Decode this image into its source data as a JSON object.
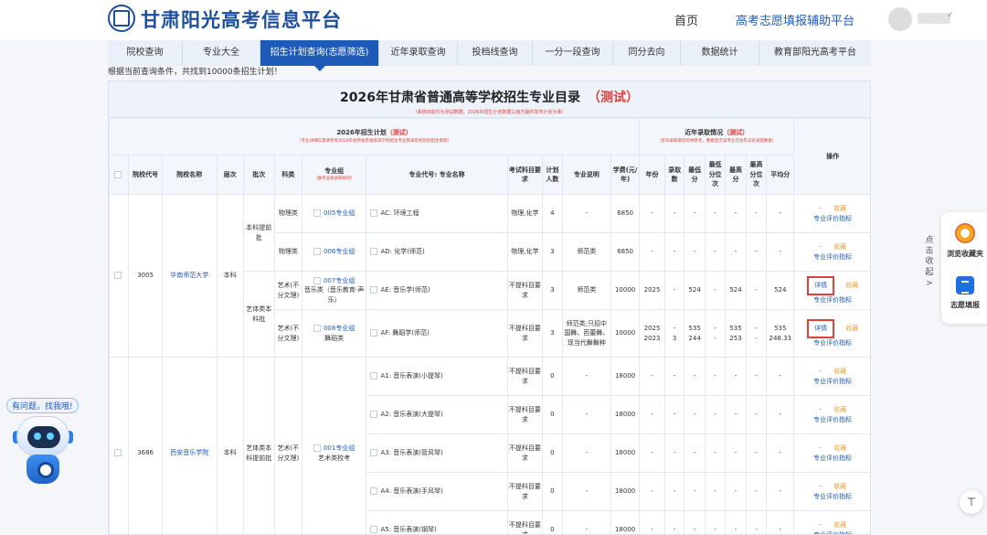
{
  "header": {
    "site_title": "甘肃阳光高考信息平台",
    "nav_home": "首页",
    "nav_assist": "高考志愿填报辅助平台"
  },
  "tabs": [
    {
      "label": "院校查询"
    },
    {
      "label": "专业大全"
    },
    {
      "label": "招生计划查询(志愿筛选)",
      "active": true
    },
    {
      "label": "近年录取查询"
    },
    {
      "label": "投档线查询"
    },
    {
      "label": "一分一段查询"
    },
    {
      "label": "同分去向"
    },
    {
      "label": "数据统计"
    },
    {
      "label": "教育部阳光高考平台"
    }
  ],
  "result_count_text": "根据当前查询条件，共找到10000条招生计划！",
  "catalog": {
    "title": "2026年甘肃省普通高等学校招生专业目录",
    "title_tag": "（测试）",
    "notice": "（系统目前均为测试数据，2026年招生计划数据以官方最终发布计划为准）"
  },
  "table": {
    "plan_section": {
      "title": "2026年招生计划",
      "tag": "（测试）",
      "note": "（专业详细信息请参考2026年甘肃省普通高等学校招生专业目录及各院校招生章程）"
    },
    "history_section": {
      "title": "近年录取情况",
      "tag": "（测试）",
      "note": "（近年录取情况仅供参考，数据显示该专业在往年没有录取数据）"
    },
    "ops_header": "操作",
    "headers": {
      "school_code": "院校代号",
      "school_name": "院校名称",
      "level": "层次",
      "batch": "批次",
      "subject": "科类",
      "group": "专业组",
      "group_note": "（备专业组录取规则）",
      "major": "专业代号: 专业名称",
      "requirement": "考试科目要求",
      "plan_count": "计划人数",
      "major_note": "专业说明",
      "tuition": "学费(元/年)",
      "year": "年份",
      "admitted": "录取数",
      "min_score": "最低分",
      "min_rank": "最低分位次",
      "max_score": "最高分",
      "max_rank": "最高分位次",
      "avg_score": "平均分"
    },
    "ops": {
      "fav": "收藏",
      "eval": "专业评价指标",
      "detail": "详情",
      "dash": "-"
    },
    "s1": {
      "code": "3005",
      "name": "华南师范大学",
      "level": "本科",
      "batch_a": "本科提前批",
      "batch_b": "艺体类本科批",
      "r1": {
        "subject": "物理类",
        "group": "005专业组",
        "major": "AC: 环境工程",
        "req": "物理,化学",
        "count": "4",
        "note": "-",
        "fee": "6850",
        "year": "-",
        "adm": "-",
        "mins": "-",
        "minr": "-",
        "maxs": "-",
        "maxr": "-",
        "avg": "-"
      },
      "r2": {
        "subject": "物理类",
        "group": "006专业组",
        "major": "AD: 化学(师范)",
        "req": "物理,化学",
        "count": "3",
        "note": "师范类",
        "fee": "6850",
        "year": "-",
        "adm": "-",
        "mins": "-",
        "minr": "-",
        "maxs": "-",
        "maxr": "-",
        "avg": "-"
      },
      "r3": {
        "subject": "艺术(不分文理)",
        "group": "007专业组",
        "group_desc": "音乐类（音乐教育-声乐）",
        "major": "AE: 音乐学(师范)",
        "req": "不提科目要求",
        "count": "3",
        "note": "师范类",
        "fee": "10000",
        "year": "2025",
        "adm": "-",
        "mins": "524",
        "minr": "-",
        "maxs": "524",
        "maxr": "-",
        "avg": "524"
      },
      "r4": {
        "subject": "艺术(不分文理)",
        "group": "008专业组",
        "group_desc": "舞蹈类",
        "major": "AF: 舞蹈学(师范)",
        "req": "不提科目要求",
        "count": "3",
        "note": "师范类;只招中国舞、芭蕾舞、现当代舞舞种",
        "fee": "10000",
        "year1": "2025",
        "adm1": "-",
        "mins1": "535",
        "minr1": "-",
        "maxs1": "535",
        "maxr1": "-",
        "avg1": "535",
        "year2": "2023",
        "adm2": "3",
        "mins2": "244",
        "minr2": "-",
        "maxs2": "253",
        "maxr2": "-",
        "avg2": "248.33"
      }
    },
    "s2": {
      "code": "3686",
      "name": "西安音乐学院",
      "level": "本科",
      "batch": "艺体类本科提前批",
      "subject": "艺术(不分文理)",
      "group": "001专业组",
      "group_desc": "艺术类校考",
      "rows": [
        {
          "major": "A1: 音乐表演(小提琴)",
          "req": "不提科目要求",
          "count": "0",
          "note": "-",
          "fee": "18000"
        },
        {
          "major": "A2: 音乐表演(大提琴)",
          "req": "不提科目要求",
          "count": "0",
          "note": "-",
          "fee": "18000"
        },
        {
          "major": "A3: 音乐表演(管风琴)",
          "req": "不提科目要求",
          "count": "0",
          "note": "-",
          "fee": "18000"
        },
        {
          "major": "A4: 音乐表演(手风琴)",
          "req": "不提科目要求",
          "count": "0",
          "note": "-",
          "fee": "18000"
        },
        {
          "major": "A5: 音乐表演(钢琴)",
          "req": "不提科目要求",
          "count": "0",
          "note": "-",
          "fee": "18000"
        }
      ]
    }
  },
  "side_panel": {
    "expand_text": "点击收起",
    "expand_arrow": ">",
    "fav_label": "浏览收藏夹",
    "fill_label": "志愿填报"
  },
  "back_top_glyph": "⊤",
  "help_bubble": "有问题，找我哦!"
}
